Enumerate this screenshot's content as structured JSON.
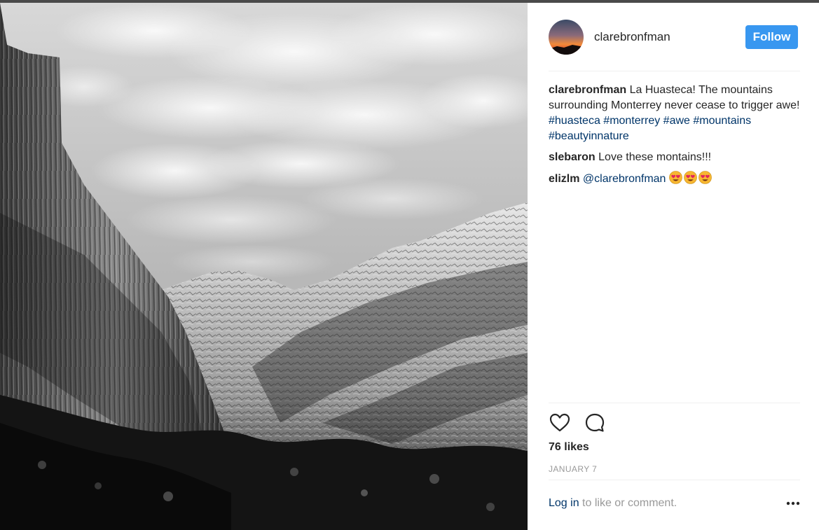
{
  "post": {
    "username": "clarebronfman",
    "follow_label": "Follow",
    "caption": {
      "user": "clarebronfman",
      "text": "La Huasteca! The mountains surrounding Monterrey never cease to trigger awe!",
      "hashtags": [
        "#huasteca",
        "#monterrey",
        "#awe",
        "#mountains",
        "#beautyinnature"
      ]
    },
    "comments": [
      {
        "user": "slebaron",
        "text": "Love these montains!!!"
      },
      {
        "user": "elizlm",
        "mention": "@clarebronfman",
        "emoji": [
          "heart-eyes-emoji",
          "heart-eyes-emoji",
          "heart-eyes-emoji"
        ]
      }
    ],
    "likes": "76 likes",
    "date": "JANUARY 7",
    "footer": {
      "login_label": "Log in",
      "rest_text": "to like or comment."
    }
  },
  "icons": {
    "like": "heart-outline-icon",
    "comment": "comment-bubble-icon",
    "more": "more-options-icon"
  },
  "colors": {
    "follow_button": "#3897f0",
    "link": "#003569",
    "muted": "#999999"
  }
}
